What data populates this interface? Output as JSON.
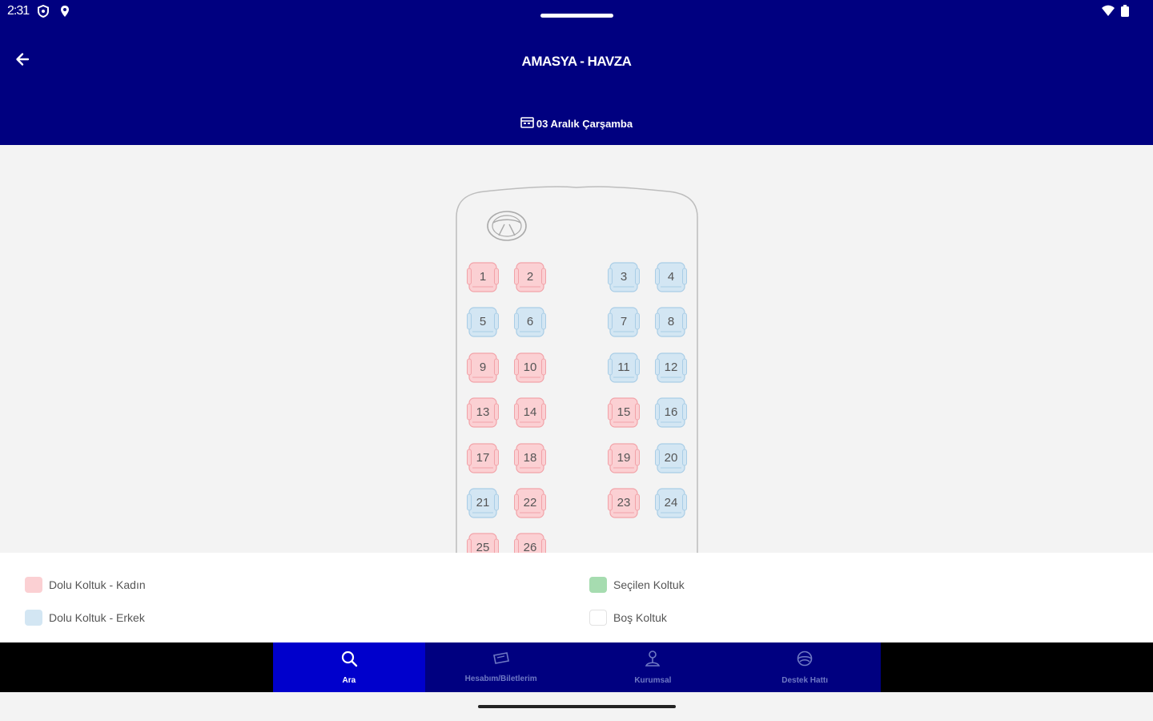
{
  "status_bar": {
    "time": "2:31",
    "icons": [
      "shield-icon",
      "location-icon",
      "wifi-icon",
      "battery-icon"
    ]
  },
  "header": {
    "back_icon": "arrow-left-icon",
    "title": "AMASYA - HAVZA",
    "date_icon": "calendar-icon",
    "date": "03 Aralık Çarşamba"
  },
  "bus": {
    "steering_icon": "steering-wheel-icon",
    "seats": [
      {
        "number": "1",
        "status": "female"
      },
      {
        "number": "2",
        "status": "female"
      },
      {
        "number": "3",
        "status": "male"
      },
      {
        "number": "4",
        "status": "male"
      },
      {
        "number": "5",
        "status": "male"
      },
      {
        "number": "6",
        "status": "male"
      },
      {
        "number": "7",
        "status": "male"
      },
      {
        "number": "8",
        "status": "male"
      },
      {
        "number": "9",
        "status": "female"
      },
      {
        "number": "10",
        "status": "female"
      },
      {
        "number": "11",
        "status": "male"
      },
      {
        "number": "12",
        "status": "male"
      },
      {
        "number": "13",
        "status": "female"
      },
      {
        "number": "14",
        "status": "female"
      },
      {
        "number": "15",
        "status": "female"
      },
      {
        "number": "16",
        "status": "male"
      },
      {
        "number": "17",
        "status": "female"
      },
      {
        "number": "18",
        "status": "female"
      },
      {
        "number": "19",
        "status": "female"
      },
      {
        "number": "20",
        "status": "male"
      },
      {
        "number": "21",
        "status": "male"
      },
      {
        "number": "22",
        "status": "female"
      },
      {
        "number": "23",
        "status": "female"
      },
      {
        "number": "24",
        "status": "male"
      },
      {
        "number": "25",
        "status": "female"
      },
      {
        "number": "26",
        "status": "female"
      }
    ]
  },
  "legend": {
    "female": "Dolu Koltuk - Kadın",
    "male": "Dolu Koltuk - Erkek",
    "selected": "Seçilen Koltuk",
    "empty": "Boş Koltuk"
  },
  "colors": {
    "header_bg": "#000080",
    "nav_active_bg": "#0000cc",
    "female_fill": "#fbd0d3",
    "female_stroke": "#f2a2a8",
    "male_fill": "#d3e6f3",
    "male_stroke": "#a9cde6",
    "selected_fill": "#a6dcb0",
    "empty_fill": "#ffffff"
  },
  "nav": {
    "items": [
      {
        "label": "Ara",
        "icon": "search-icon",
        "active": true
      },
      {
        "label": "Hesabım/Biletlerim",
        "icon": "ticket-icon",
        "active": false
      },
      {
        "label": "Kurumsal",
        "icon": "info-icon",
        "active": false
      },
      {
        "label": "Destek Hattı",
        "icon": "support-icon",
        "active": false
      }
    ]
  }
}
